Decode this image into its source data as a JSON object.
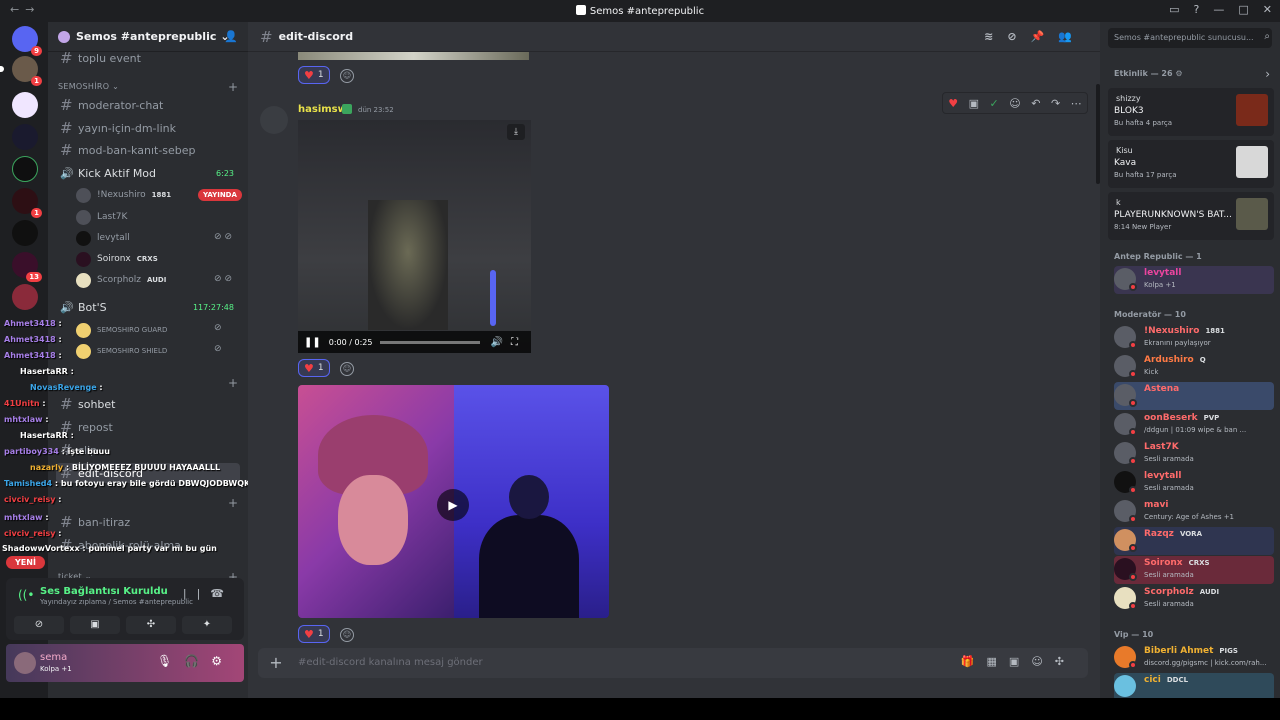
{
  "window": {
    "title": "Semos #anteprepublic"
  },
  "guilds": {
    "badges": [
      "9",
      "1",
      "1",
      "13"
    ]
  },
  "sidebar": {
    "server_name": "Semos #anteprepublic",
    "top_channel": "toplu event",
    "cat_semoshiro": "SEMOSHİRO",
    "channels": [
      "moderator-chat",
      "yayın-için-dm-link",
      "mod-ban-kanıt-sebep"
    ],
    "voice_kick": {
      "name": "Kick Aktif Mod",
      "time": "6:23"
    },
    "voice_users": [
      {
        "name": "!Nexushiro",
        "tag": "1881",
        "live": "YAYINDA"
      },
      {
        "name": "Last7K",
        "tag": ""
      },
      {
        "name": "levytall",
        "tag": ""
      },
      {
        "name": "Soironx",
        "tag": "CRXS"
      },
      {
        "name": "Scorpholz",
        "tag": "AUDI"
      }
    ],
    "voice_bots": {
      "name": "Bot'S",
      "time": "117:27:48"
    },
    "bot_users": [
      "SEMOSHIRO GUARD",
      "SEMOSHIRO SHIELD"
    ],
    "channels2": [
      "sohbet",
      "repost",
      "clip",
      "edit-discord",
      "ban-itiraz",
      "abonelik-rolü-alma"
    ],
    "cat_ticket": "ticket"
  },
  "overlay_chat": [
    {
      "u": "Ahmet3418",
      "m": ""
    },
    {
      "u": "Ahmet3418",
      "m": ""
    },
    {
      "u": "Ahmet3418",
      "m": ""
    },
    {
      "u": "HasertaRR",
      "m": ""
    },
    {
      "u": "NovasRevenge",
      "m": ""
    },
    {
      "u": "41Unitn",
      "m": ""
    },
    {
      "u": "mhtxlaw",
      "m": ""
    },
    {
      "u": "HasertaRR",
      "m": ""
    },
    {
      "u": "partiboy334",
      "m": "işte buuu"
    },
    {
      "u": "nazarly",
      "m": "BİLİYOMEEEZ BUUUU HAYAAALLL"
    },
    {
      "u": "Tamished4",
      "m": "bu fotoyu eray bile gördü DBWQJODBWQKLJDBKQWJLBDQ"
    },
    {
      "u": "civciv_reisy",
      "m": ""
    },
    {
      "u": "mhtxlaw",
      "m": ""
    },
    {
      "u": "civciv_reisy",
      "m": ""
    },
    {
      "u": "ShadowwVortexx",
      "m": "pummel party var mı bu gün"
    }
  ],
  "yeni": "YENİ",
  "voice_panel": {
    "title": "Ses Bağlantısı Kuruldu",
    "sub": "Yayındayız zıplama / Semos #anteprepublic"
  },
  "user_panel": {
    "name": "sema",
    "status": "Kolpa +1"
  },
  "main": {
    "channel": "edit-discord",
    "reactions": [
      "1",
      "1",
      "1"
    ],
    "author": "hasimsw",
    "time": "dün 23:52",
    "video_time": "0:00 / 0:25",
    "composer_placeholder": "#edit-discord kanalına mesaj gönder"
  },
  "right": {
    "search": "Semos #anteprepublic sunucusu...",
    "activity_title": "Etkinlik — 26",
    "activities": [
      {
        "user": "shizzy",
        "title": "BLOK3",
        "sub": "Bu hafta 4 parça"
      },
      {
        "user": "Kisu",
        "title": "Kava",
        "sub": "Bu hafta 17 parça"
      },
      {
        "user": "k",
        "title": "PLAYERUNKNOWN'S BAT...",
        "sub": "8:14  New Player"
      }
    ],
    "sec_antep": "Antep Republic — 1",
    "antep_members": [
      {
        "name": "levytall",
        "status": "Kolpa +1",
        "color": "#eb459e"
      }
    ],
    "sec_mod": "Moderatör — 10",
    "mods": [
      {
        "name": "!Nexushiro",
        "tag": "1881",
        "status": "Ekranını paylaşıyor",
        "color": "#ff6b6b"
      },
      {
        "name": "Ardushiro",
        "tag": "Q",
        "status": "Kick",
        "color": "#ff7a45"
      },
      {
        "name": "Astena",
        "tag": "",
        "status": "",
        "color": "#ff6b6b"
      },
      {
        "name": "oonBeserk",
        "tag": "PVP",
        "status": "/ddgun | 01:09 wipe & ban ...",
        "color": "#ff6b6b"
      },
      {
        "name": "Last7K",
        "tag": "",
        "status": "Sesli aramada",
        "color": "#ff6b6b"
      },
      {
        "name": "levytall",
        "tag": "",
        "status": "Sesli aramada",
        "color": "#ff6b6b"
      },
      {
        "name": "mavi",
        "tag": "",
        "status": "Century: Age of Ashes +1",
        "color": "#ff6b6b"
      },
      {
        "name": "Razqz",
        "tag": "VORA",
        "status": "",
        "color": "#ff6b6b"
      },
      {
        "name": "Soironx",
        "tag": "CRXS",
        "status": "Sesli aramada",
        "color": "#ff6b6b"
      },
      {
        "name": "Scorpholz",
        "tag": "AUDI",
        "status": "Sesli aramada",
        "color": "#ff6b6b"
      }
    ],
    "sec_vip": "Vip — 10",
    "vips": [
      {
        "name": "Biberli Ahmet",
        "tag": "PIGS",
        "status": "discord.gg/pigsmc | kick.com/rah...",
        "color": "#f0b132"
      },
      {
        "name": "cici",
        "tag": "DDCL",
        "status": "",
        "color": "#f0b132"
      }
    ]
  }
}
